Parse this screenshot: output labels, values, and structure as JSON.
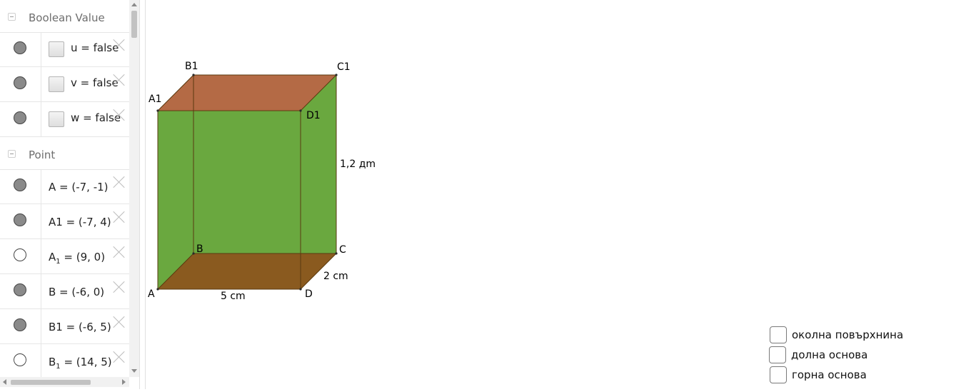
{
  "algebra": {
    "groups": [
      {
        "label": "Boolean Value"
      },
      {
        "label": "Point"
      }
    ],
    "booleans": [
      {
        "name": "u",
        "eq": "=",
        "value": "false"
      },
      {
        "name": "v",
        "eq": "=",
        "value": "false"
      },
      {
        "name": "w",
        "eq": "=",
        "value": "false"
      }
    ],
    "points": [
      {
        "text": "A = (-7, -1)",
        "shown": true
      },
      {
        "text": "A1 = (-7, 4)",
        "shown": true
      },
      {
        "base": "A",
        "sub": "1",
        "rest": " = (9, 0)",
        "shown": false
      },
      {
        "text": "B = (-6, 0)",
        "shown": true
      },
      {
        "text": "B1 = (-6, 5)",
        "shown": true
      },
      {
        "base": "B",
        "sub": "1",
        "rest": " = (14, 5)",
        "shown": false
      }
    ]
  },
  "graphics": {
    "labels": {
      "A": "A",
      "B": "B",
      "C": "C",
      "D": "D",
      "A1": "A1",
      "B1": "B1",
      "C1": "C1",
      "D1": "D1",
      "height": "1,2 дm",
      "width": "5 cm",
      "depth": "2 cm"
    },
    "colors": {
      "lateral": "#6aa83f",
      "top": "#b46a45",
      "bottom": "#8a5a1f",
      "edge": "#5a3a10"
    },
    "checkboxes": [
      {
        "label": "околна повърхнина"
      },
      {
        "label": "долна основа"
      },
      {
        "label": "горна основа"
      }
    ]
  }
}
